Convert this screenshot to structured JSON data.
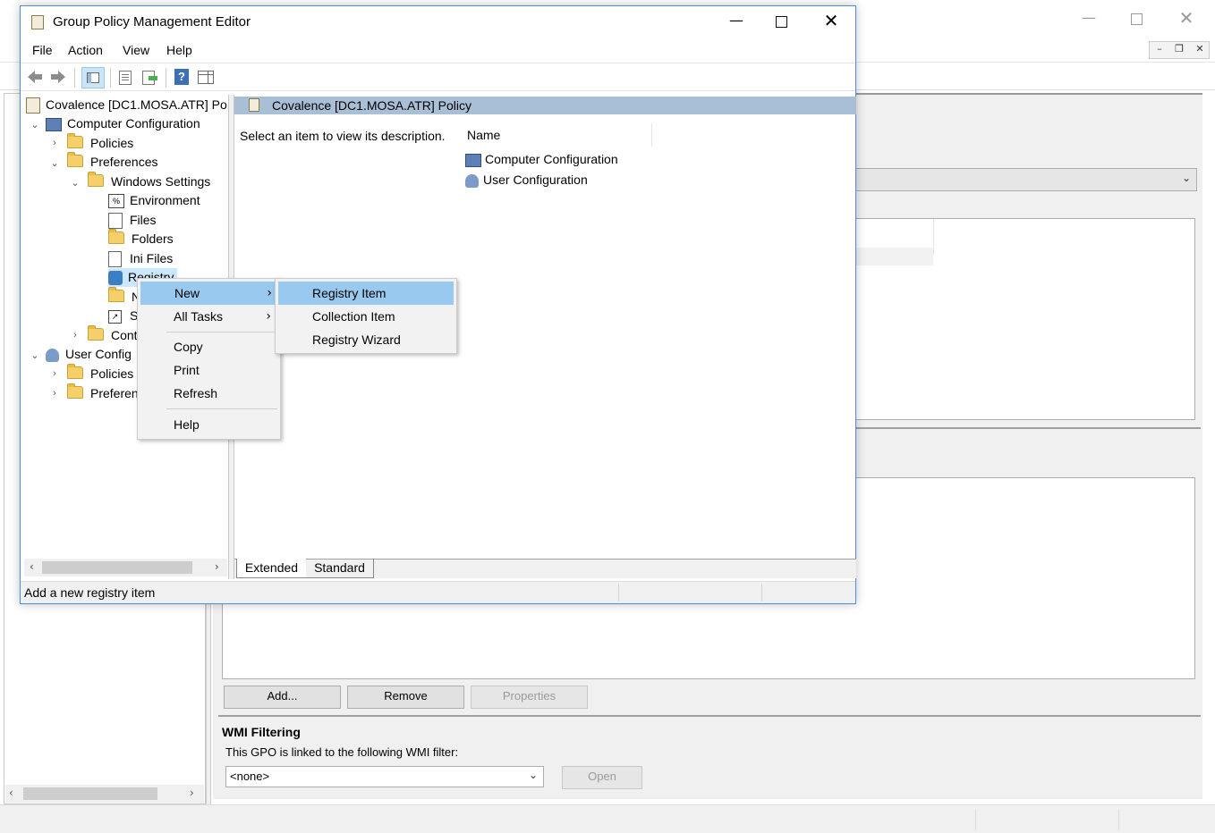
{
  "bg_window": {
    "wmi": {
      "heading": "WMI Filtering",
      "description": "This GPO is linked to the following WMI filter:",
      "select_value": "<none>",
      "open_label": "Open"
    },
    "buttons": {
      "add": "Add...",
      "remove": "Remove",
      "properties": "Properties"
    }
  },
  "editor": {
    "title": "Group Policy Management Editor",
    "menu": [
      "File",
      "Action",
      "View",
      "Help"
    ],
    "tree": {
      "root": "Covalence [DC1.MOSA.ATR] Po",
      "computer_config": "Computer Configuration",
      "policies": "Policies",
      "preferences": "Preferences",
      "windows_settings": "Windows Settings",
      "environment": "Environment",
      "files": "Files",
      "folders": "Folders",
      "ini_files": "Ini Files",
      "registry": "Registry",
      "network_shares_partial": "N",
      "shortcuts_partial": "S",
      "control_panel_partial": "Cont",
      "user_config": "User Config",
      "user_policies": "Policies",
      "user_preferences": "Preferen"
    },
    "right_pane": {
      "header": "Covalence [DC1.MOSA.ATR] Policy",
      "description": "Select an item to view its description.",
      "column_name": "Name",
      "items": [
        "Computer Configuration",
        "User Configuration"
      ]
    },
    "tabs": [
      "Extended",
      "Standard"
    ],
    "status": "Add a new registry item"
  },
  "context_menu": {
    "items": [
      "New",
      "All Tasks",
      "Copy",
      "Print",
      "Refresh",
      "Help"
    ]
  },
  "submenu": {
    "items": [
      "Registry Item",
      "Collection Item",
      "Registry Wizard"
    ]
  },
  "colors": {
    "selection": "#99c9ef",
    "pane_header": "#a9bfd6",
    "window_border": "#4a90d9"
  }
}
